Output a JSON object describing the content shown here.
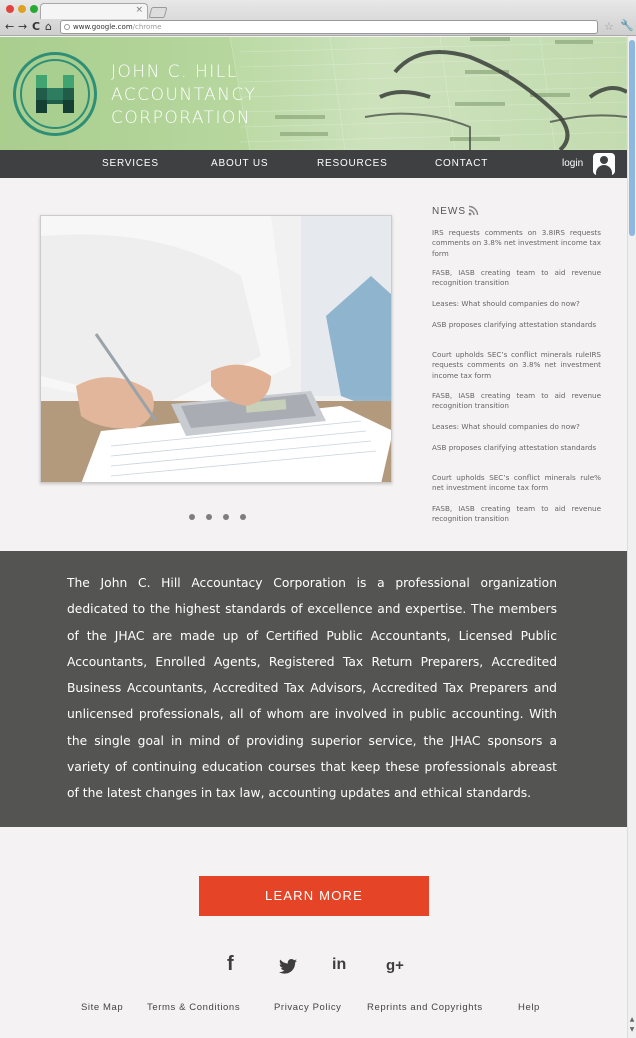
{
  "browser": {
    "tab_close": "×",
    "url_host": "www.google.com",
    "url_path": "/chrome",
    "back": "←",
    "forward": "→",
    "reload": "C",
    "home": "⌂",
    "star": "☆",
    "wrench": "🔧",
    "scroll_up": "▲",
    "scroll_down": "▼"
  },
  "brand": {
    "line1": "JOHN C. HILL",
    "line2": "ACCOUNTANCY",
    "line3": "CORPORATION",
    "logo_colors": {
      "dark": "#1f5d49",
      "mid": "#2f8f76",
      "light": "#6bb38c"
    }
  },
  "nav": {
    "items": [
      "SERVICES",
      "ABOUT US",
      "RESOURCES",
      "CONTACT"
    ],
    "login": "login"
  },
  "news": {
    "title": "NEWS",
    "items": [
      "IRS requests comments on 3.8IRS requests comments on 3.8% net investment income tax form",
      "FASB, IASB creating team to aid revenue recognition transition",
      "Leases: What should companies do now?",
      "ASB proposes clarifying attestation standards",
      "Court upholds SEC’s conflict minerals ruleIRS requests comments on 3.8% net investment income tax form",
      "FASB, IASB creating team to aid revenue recognition transition",
      "Leases: What should companies do now?",
      "ASB proposes clarifying attestation standards",
      "Court upholds SEC’s conflict minerals rule% net investment income tax form",
      "FASB, IASB creating team to aid revenue recognition transition"
    ]
  },
  "carousel": {
    "slide_count": 4,
    "active_index": 0
  },
  "about": {
    "text": "The John C. Hill Accountacy Corporation is a professional organization dedicated to the highest standards of excellence and expertise. The members of the JHAC are made up of Certified Public Accountants, Licensed Public Accountants, Enrolled Agents, Registered Tax Return Preparers, Accredited Business Accountants, Accredited Tax Advisors, Accredited Tax Preparers and unlicensed professionals, all of whom are involved in public accounting. With the single goal in mind of providing superior service, the JHAC sponsors a variety of continuing education courses that keep these professionals abreast of the latest changes in tax law, accounting updates and ethical standards."
  },
  "cta": {
    "label": "LEARN MORE"
  },
  "social": {
    "facebook": "f",
    "linkedin": "in",
    "googleplus": "g+"
  },
  "footer": {
    "links": [
      "Site Map",
      "Terms & Conditions",
      "Privacy Policy",
      "Reprints and Copyrights",
      "Help"
    ]
  },
  "colors": {
    "accent": "#e54427",
    "nav_bg": "#3f4041",
    "band_bg": "#545453",
    "header_green": "#b7d79f"
  }
}
